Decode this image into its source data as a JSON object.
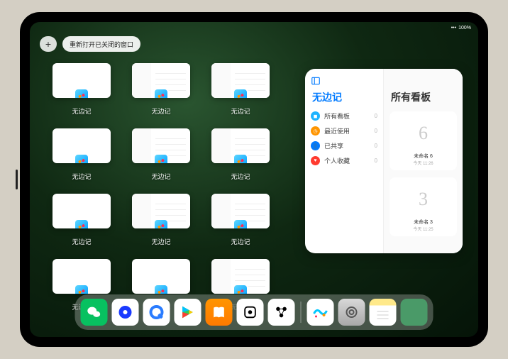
{
  "status": {
    "battery": "100%",
    "wifi": "•••"
  },
  "toolbar": {
    "add_label": "+",
    "reopen_label": "重新打开已关闭的窗口"
  },
  "windows": {
    "label": "无边记",
    "items": [
      {
        "style": "blank"
      },
      {
        "style": "tiled"
      },
      {
        "style": "tiled"
      },
      {
        "style": "blank"
      },
      {
        "style": "tiled"
      },
      {
        "style": "tiled"
      },
      {
        "style": "blank"
      },
      {
        "style": "tiled"
      },
      {
        "style": "tiled"
      },
      {
        "style": "blank"
      },
      {
        "style": "blank"
      },
      {
        "style": "tiled"
      }
    ]
  },
  "panel": {
    "ellipsis": "•••",
    "left_title": "无边记",
    "right_title": "所有看板",
    "categories": [
      {
        "label": "所有看板",
        "count": "0",
        "color": "#1db3ff"
      },
      {
        "label": "最近使用",
        "count": "0",
        "color": "#ff9500"
      },
      {
        "label": "已共享",
        "count": "0",
        "color": "#007aff"
      },
      {
        "label": "个人收藏",
        "count": "0",
        "color": "#ff3b30"
      }
    ],
    "boards": [
      {
        "glyph": "6",
        "name": "未命名 6",
        "sub": "今天 11:26"
      },
      {
        "glyph": "3",
        "name": "未命名 3",
        "sub": "今天 11:25"
      }
    ]
  },
  "dock": [
    {
      "name": "wechat"
    },
    {
      "name": "quark-blue"
    },
    {
      "name": "browser-q"
    },
    {
      "name": "play-store"
    },
    {
      "name": "books"
    },
    {
      "name": "dice"
    },
    {
      "name": "connect"
    },
    {
      "name": "freeform"
    },
    {
      "name": "settings"
    },
    {
      "name": "notes"
    },
    {
      "name": "app-library"
    }
  ]
}
